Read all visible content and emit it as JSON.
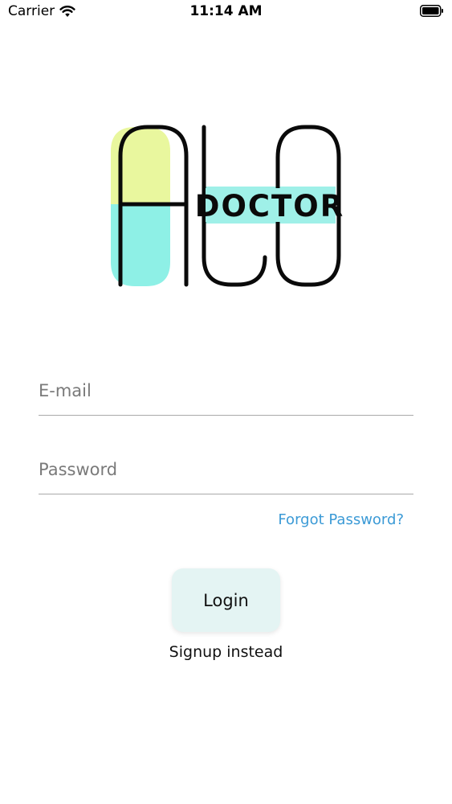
{
  "status_bar": {
    "carrier": "Carrier",
    "time": "11:14 AM"
  },
  "logo": {
    "word": "DOCTOR",
    "colors": {
      "pill_top": "#e9f79e",
      "pill_bottom": "#8ef0e6",
      "band": "#9ff0e8",
      "stroke": "#0a0a0a"
    }
  },
  "form": {
    "email_placeholder": "E-mail",
    "email_value": "",
    "password_placeholder": "Password",
    "password_value": "",
    "forgot_label": "Forgot Password?",
    "login_label": "Login",
    "signup_label": "Signup instead"
  },
  "colors": {
    "link": "#3b9ad6",
    "button_bg": "#e4f4f3",
    "underline": "#a9a9a9"
  }
}
